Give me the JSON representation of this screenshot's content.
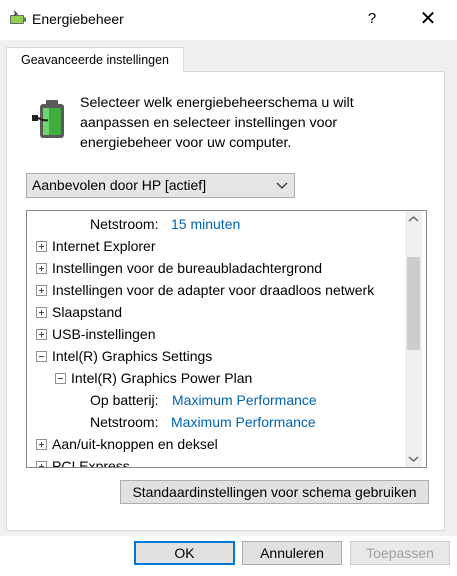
{
  "window": {
    "title": "Energiebeheer",
    "help_label": "?",
    "close_label": "✕"
  },
  "tab": {
    "label": "Geavanceerde instellingen"
  },
  "intro_text": "Selecteer welk energiebeheerschema u wilt aanpassen en selecteer instellingen voor energiebeheer voor uw computer.",
  "scheme_select": {
    "value": "Aanbevolen door HP [actief]"
  },
  "tree": {
    "items": [
      {
        "label": "Netstroom:",
        "value": "15 minuten",
        "expander": "none",
        "level": 3
      },
      {
        "label": "Internet Explorer",
        "expander": "plus",
        "level": 0
      },
      {
        "label": "Instellingen voor de bureaubladachtergrond",
        "expander": "plus",
        "level": 0
      },
      {
        "label": "Instellingen voor de adapter voor draadloos netwerk",
        "expander": "plus",
        "level": 0
      },
      {
        "label": "Slaapstand",
        "expander": "plus",
        "level": 0
      },
      {
        "label": "USB-instellingen",
        "expander": "plus",
        "level": 0
      },
      {
        "label": "Intel(R) Graphics Settings",
        "expander": "minus",
        "level": 0
      },
      {
        "label": "Intel(R) Graphics Power Plan",
        "expander": "minus",
        "level": 1
      },
      {
        "label": "Op batterij:",
        "value": "Maximum Performance",
        "expander": "none",
        "level": 3
      },
      {
        "label": "Netstroom:",
        "value": "Maximum Performance",
        "expander": "none",
        "level": 3
      },
      {
        "label": "Aan/uit-knoppen en deksel",
        "expander": "plus",
        "level": 0
      },
      {
        "label": "PCI Express",
        "expander": "plus",
        "level": 0
      }
    ]
  },
  "buttons": {
    "restore_defaults": "Standaardinstellingen voor schema gebruiken",
    "ok": "OK",
    "cancel": "Annuleren",
    "apply": "Toepassen"
  },
  "colors": {
    "link": "#0063b1",
    "focus_border": "#0078d7",
    "dialog_bg": "#f0f0f0"
  }
}
